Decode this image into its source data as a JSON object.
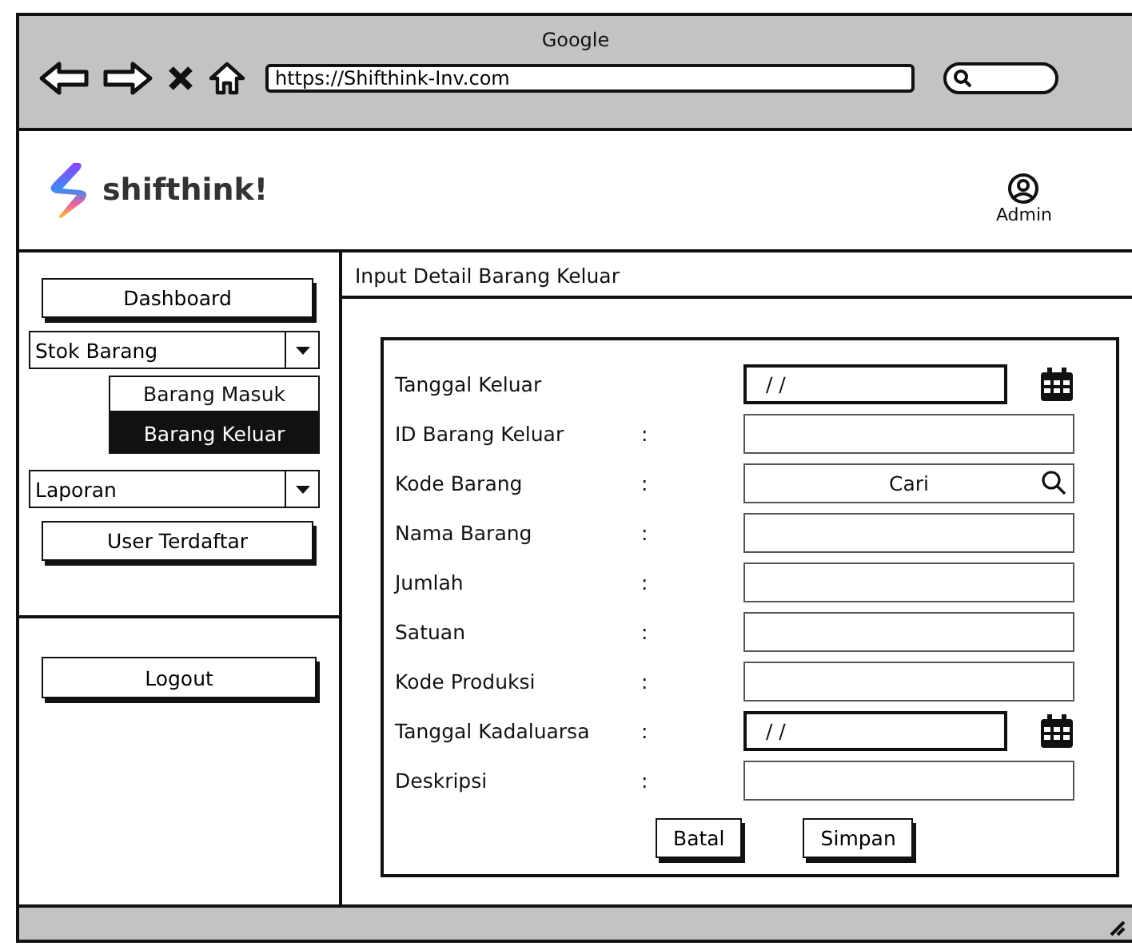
{
  "browser": {
    "title": "Google",
    "url": "https://Shifthink-Inv.com"
  },
  "header": {
    "brand": "shifthink!",
    "user": "Admin"
  },
  "sidebar": {
    "items": [
      {
        "kind": "button",
        "label": "Dashboard"
      },
      {
        "kind": "dropdown",
        "label": "Stok Barang",
        "children": [
          {
            "label": "Barang Masuk",
            "selected": false
          },
          {
            "label": "Barang Keluar",
            "selected": true
          }
        ]
      },
      {
        "kind": "dropdown",
        "label": "Laporan"
      },
      {
        "kind": "button",
        "label": "User Terdaftar"
      }
    ],
    "logout": "Logout"
  },
  "form": {
    "title": "Input Detail Barang Keluar",
    "fields": [
      {
        "kind": "date",
        "label": "Tanggal Keluar",
        "placeholder": "/ /"
      },
      {
        "kind": "text",
        "label": "ID Barang Keluar",
        "colon": ":"
      },
      {
        "kind": "search",
        "label": "Kode Barang",
        "colon": ":",
        "placeholder": "Cari"
      },
      {
        "kind": "text",
        "label": "Nama Barang",
        "colon": ":"
      },
      {
        "kind": "text",
        "label": "Jumlah",
        "colon": ":"
      },
      {
        "kind": "text",
        "label": "Satuan",
        "colon": ":"
      },
      {
        "kind": "text",
        "label": "Kode Produksi",
        "colon": ":"
      },
      {
        "kind": "date",
        "label": "Tanggal Kadaluarsa",
        "colon": ":",
        "placeholder": "/ /"
      },
      {
        "kind": "text",
        "label": "Deskripsi",
        "colon": ":"
      }
    ],
    "buttons": [
      "Batal",
      "Simpan"
    ]
  }
}
